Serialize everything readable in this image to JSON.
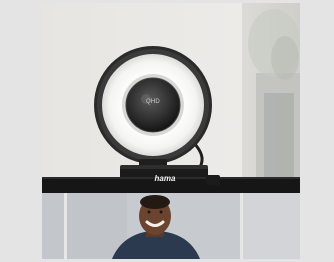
{
  "scene": {
    "description_tags": [
      "webcam-with-ring-light",
      "monitor",
      "video-call-participant"
    ],
    "brand_mark": "hama",
    "lens_label": "QHD",
    "colors": {
      "background": "#e4e4e4",
      "ring_light": "#f7f7f5",
      "camera_body": "#1b1b1b",
      "monitor_bezel": "#161616"
    }
  }
}
